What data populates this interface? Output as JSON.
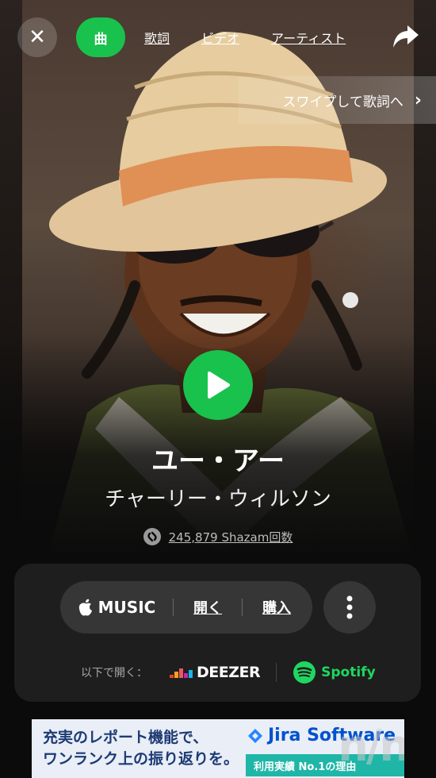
{
  "header": {
    "close_icon": "close-icon",
    "tabs": [
      {
        "label": "曲",
        "active": true
      },
      {
        "label": "歌詞"
      },
      {
        "label": "ビデオ"
      },
      {
        "label": "アーティスト"
      }
    ],
    "share_icon": "share-icon"
  },
  "swipe_hint": {
    "label": "スワイプして歌詞へ"
  },
  "track": {
    "title": "ユー・アー",
    "artist": "チャーリー・ウィルソン",
    "shazam_count": "245,879 Shazam回数"
  },
  "provider": {
    "brand": "MUSIC",
    "open_label": "開く",
    "buy_label": "購入",
    "open_in_label": "以下で開く：",
    "deezer_label": "DEEZER",
    "spotify_label": "Spotify"
  },
  "ad": {
    "line1": "充実のレポート機能で、",
    "line2": "ワンランク上の振り返りを。",
    "brand": "Jira Software",
    "strip": "利用実績 No.1の理由",
    "watermark": "n/n"
  },
  "colors": {
    "accent": "#19c24d",
    "spotify": "#1ed760",
    "card": "#1e1e1e",
    "pill": "#363636"
  }
}
